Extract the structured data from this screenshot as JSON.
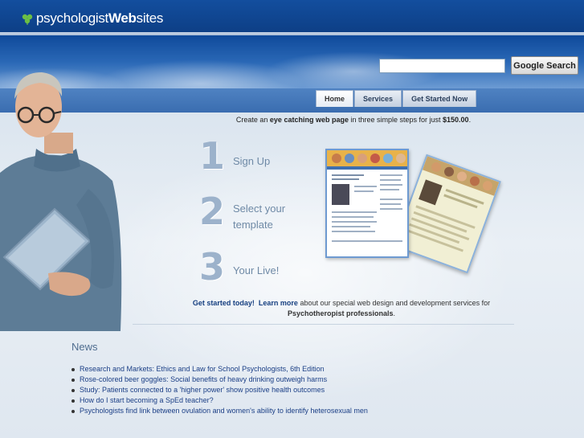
{
  "brand": {
    "logo_thin": "psychologist",
    "logo_bold": "Web",
    "logo_thin_end": "sites",
    "accent": "#0f4a9b"
  },
  "search": {
    "placeholder": "",
    "value": "",
    "button_label": "Google Search"
  },
  "nav": {
    "tabs": [
      {
        "label": "Home",
        "active": true
      },
      {
        "label": "Services",
        "active": false
      },
      {
        "label": "Get Started Now",
        "active": false
      }
    ]
  },
  "hero": {
    "tagline_pre": "Create an ",
    "tagline_emph": "eye catching web page",
    "tagline_mid": " in three simple steps for just ",
    "tagline_price": "$150.00",
    "tagline_end": ".",
    "steps": [
      {
        "number": "1",
        "label": "Sign Up"
      },
      {
        "number": "2",
        "label": "Select your template"
      },
      {
        "number": "3",
        "label": "Your Live!"
      }
    ],
    "cta_get_started": "Get started today!",
    "cta_learn_more": "Learn more",
    "cta_text": " about our special web design and development services for",
    "cta_audience": "Psychotheropist professionals",
    "cta_end": "."
  },
  "news": {
    "heading": "News",
    "items": [
      "Research and Markets: Ethics and Law for School Psychologists, 6th Edition",
      "Rose-colored beer goggles: Social benefits of heavy drinking outweigh harms",
      "Study: Patients connected to a 'higher power' show positive health outcomes",
      "How do I start becoming a SpEd teacher?",
      "Psychologists find link between ovulation and women's ability to identify heterosexual men"
    ]
  }
}
